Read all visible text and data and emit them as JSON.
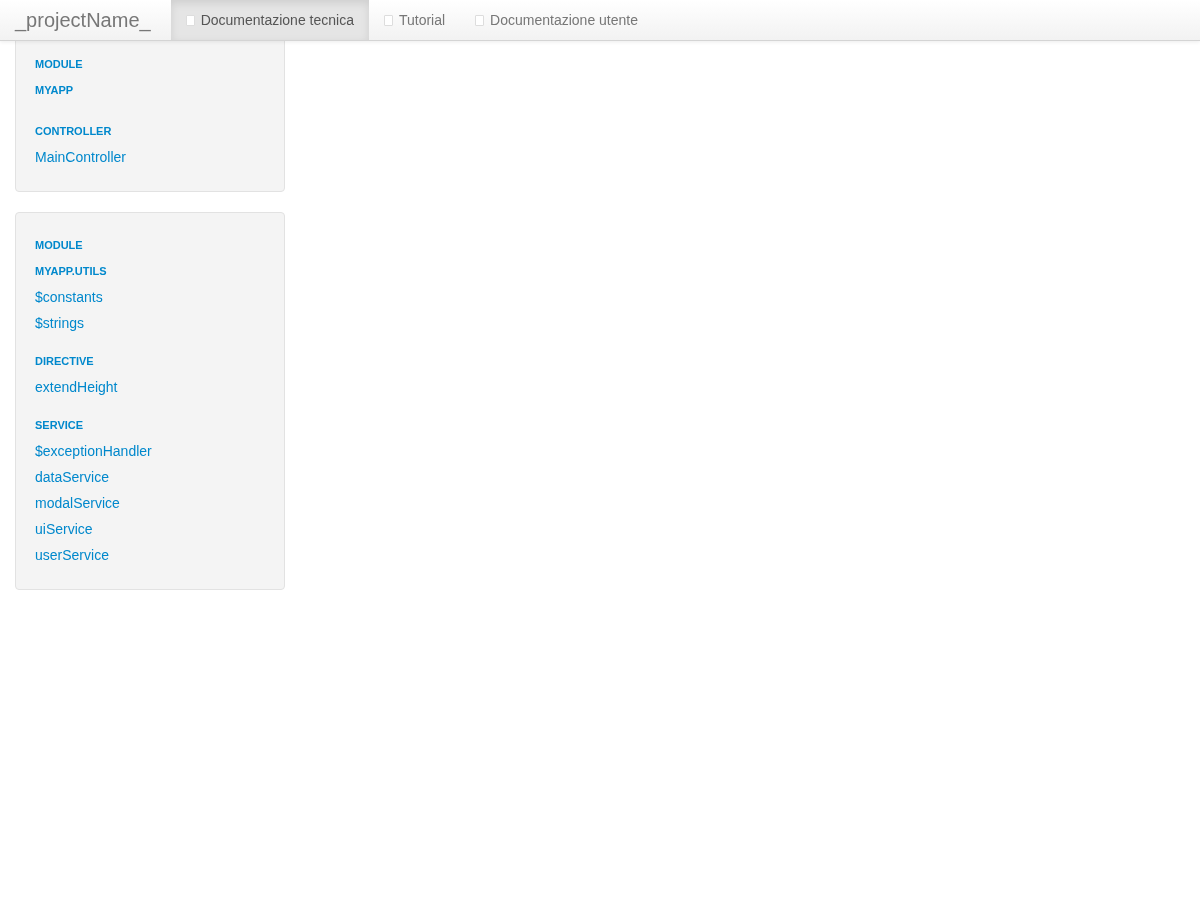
{
  "navbar": {
    "brand": "_projectName_",
    "tabs": [
      {
        "label": "Documentazione tecnica",
        "selected": true
      },
      {
        "label": "Tutorial",
        "selected": false
      },
      {
        "label": "Documentazione utente",
        "selected": false
      }
    ]
  },
  "panels": [
    {
      "module_label": "MODULE",
      "module_name": "MYAPP",
      "sections": [
        {
          "title": "CONTROLLER",
          "links": [
            "MainController"
          ]
        }
      ]
    },
    {
      "module_label": "MODULE",
      "module_name": "MYAPP.UTILS",
      "sections": [
        {
          "links": [
            "$constants",
            "$strings"
          ]
        },
        {
          "title": "DIRECTIVE",
          "links": [
            "extendHeight"
          ]
        },
        {
          "title": "SERVICE",
          "links": [
            "$exceptionHandler",
            "dataService",
            "modalService",
            "uiService",
            "userService"
          ]
        }
      ]
    }
  ]
}
